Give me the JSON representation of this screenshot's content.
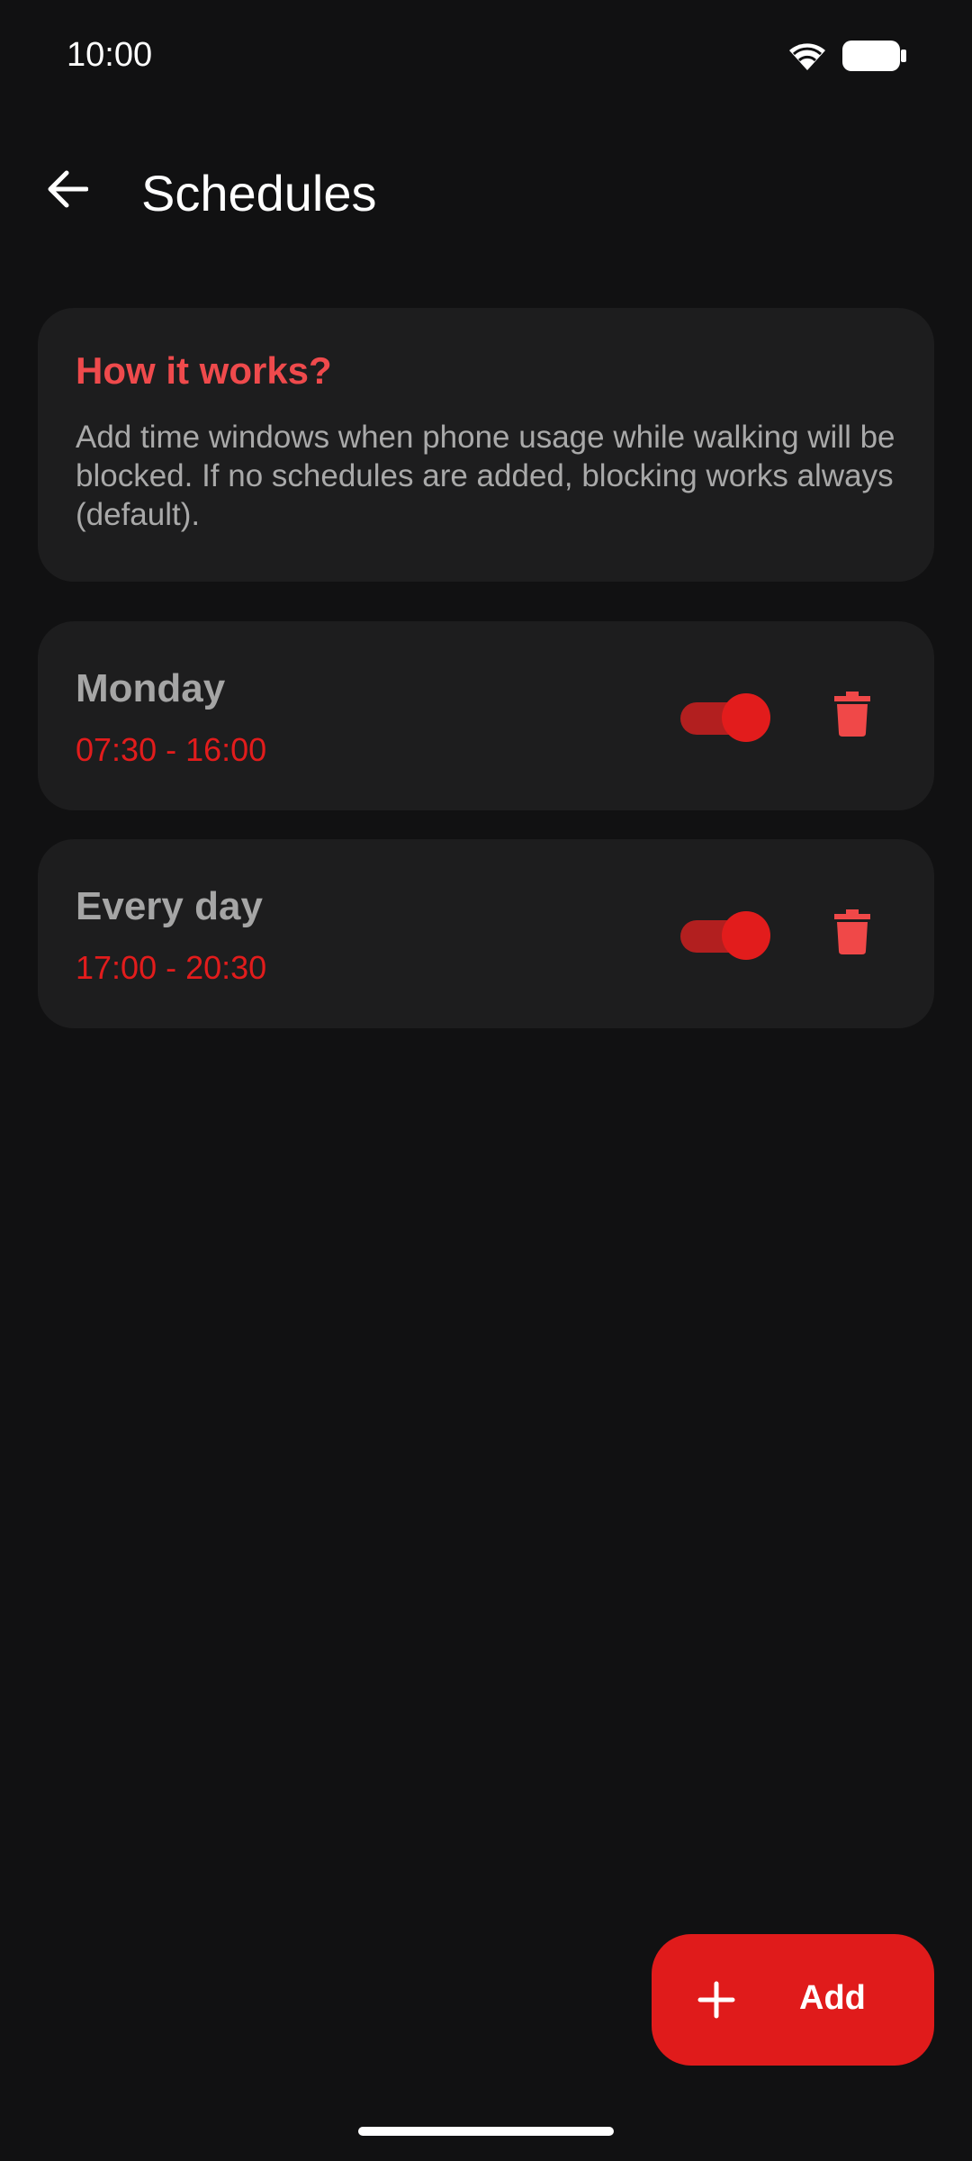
{
  "status_bar": {
    "time": "10:00",
    "icons": [
      "wifi-icon",
      "battery-icon"
    ]
  },
  "app_bar": {
    "back_icon": "arrow-left-icon",
    "title": "Schedules"
  },
  "info_card": {
    "title": "How it works?",
    "text": "Add time windows when phone usage while walking will be blocked. If no schedules are added, blocking works always (default)."
  },
  "schedules": [
    {
      "name": "Monday",
      "time_range": "07:30 - 16:00",
      "enabled": true,
      "delete_icon": "trash-icon"
    },
    {
      "name": "Every day",
      "time_range": "17:00 - 20:30",
      "enabled": true,
      "delete_icon": "trash-icon"
    }
  ],
  "fab": {
    "icon": "plus-icon",
    "label": "Add"
  },
  "colors": {
    "background": "#111112",
    "card": "#1d1d1e",
    "accent": "#e01b1b",
    "accent_light": "#ef4a4c",
    "toggle_track": "#b21f1f",
    "text_muted": "#a9a9a9"
  }
}
